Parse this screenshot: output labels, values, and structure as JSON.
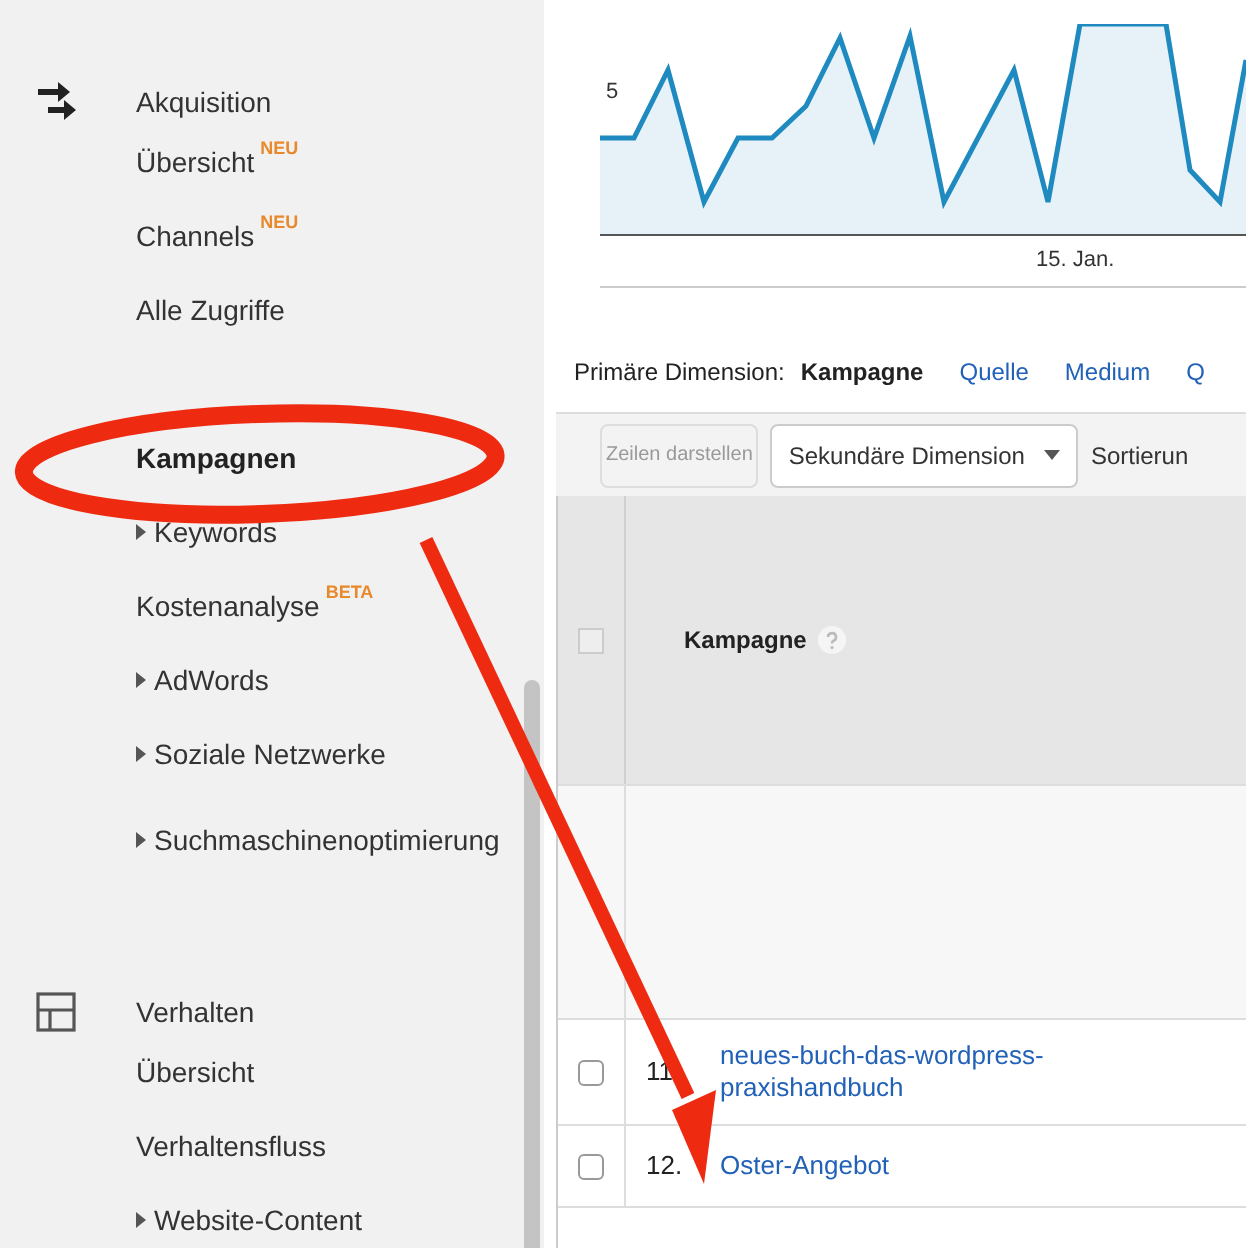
{
  "sidebar": {
    "sections": [
      {
        "title": "Akquisition",
        "kind": "arrows",
        "items": [
          {
            "label": "Übersicht",
            "badge": "NEU",
            "expandable": false,
            "selected": false
          },
          {
            "label": "Channels",
            "badge": "NEU",
            "expandable": false,
            "selected": false
          },
          {
            "label": "Alle Zugriffe",
            "expandable": false,
            "selected": false
          },
          {
            "kind": "covered"
          },
          {
            "label": "Kampagnen",
            "expandable": false,
            "selected": true
          },
          {
            "label": "Keywords",
            "expandable": true,
            "selected": false
          },
          {
            "label": "Kostenanalyse",
            "badge": "BETA",
            "expandable": false,
            "selected": false
          },
          {
            "label": "AdWords",
            "expandable": true,
            "selected": false
          },
          {
            "label": "Soziale Netzwerke",
            "expandable": true,
            "selected": false
          },
          {
            "label": "Suchmaschinenoptimierung",
            "expandable": true,
            "selected": false
          }
        ]
      },
      {
        "title": "Verhalten",
        "kind": "layout",
        "items": [
          {
            "label": "Übersicht",
            "expandable": false,
            "selected": false
          },
          {
            "label": "Verhaltensfluss",
            "expandable": false,
            "selected": false
          },
          {
            "label": "Website-Content",
            "expandable": true,
            "selected": false
          }
        ]
      }
    ]
  },
  "chart": {
    "y_label": "5",
    "x_label": "15. Jan."
  },
  "dimension_bar": {
    "label": "Primäre Dimension:",
    "options": [
      {
        "label": "Kampagne",
        "selected": true
      },
      {
        "label": "Quelle",
        "selected": false
      },
      {
        "label": "Medium",
        "selected": false
      },
      {
        "label": "Q",
        "selected": false
      }
    ]
  },
  "toolbar": {
    "rows_button": {
      "label": "Zeilen darstellen",
      "disabled": true
    },
    "secondary_dimension": "Sekundäre Dimension",
    "sort_label": "Sortierun"
  },
  "table": {
    "column": "Kampagne",
    "all_checked": false,
    "rows": [
      {
        "index": "11",
        "name": "neues-buch-das-wordpress-praxishandbuch",
        "checked": false
      },
      {
        "index": "12.",
        "name": "Oster-Angebot",
        "checked": false
      }
    ]
  }
}
